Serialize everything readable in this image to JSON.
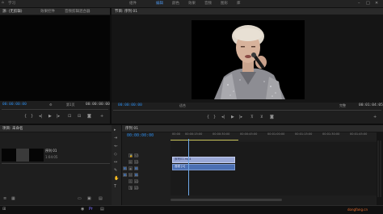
{
  "menu": {
    "items": [
      "学习",
      "组件",
      "编辑",
      "颜色",
      "效果",
      "音频",
      "图形",
      "库"
    ],
    "active_index": 2
  },
  "source_panel": {
    "tabs": [
      "源: (无剪辑)",
      "效果控件",
      "音频剪辑混合器"
    ],
    "timecode_left": "00:00:00:00",
    "timecode_right": "00:00:00:00",
    "page_label": "第1页"
  },
  "program_panel": {
    "tab": "节目: 序列 01",
    "timecode_left": "00:00:00:00",
    "fit_label": "适合",
    "ratio_label": "完整",
    "timecode_right": "00:01:04:05"
  },
  "project_panel": {
    "tab": "项目: 未命名",
    "clip_name": "序列 01",
    "clip_duration": "1:04:05"
  },
  "timeline_panel": {
    "tab": "序列 01",
    "timecode": "00:00:00:00",
    "ruler_labels": [
      "00:00",
      "00:00:15:00",
      "00:00:30:00",
      "00:00:45:00",
      "00:01:00:00",
      "00:01:15:00",
      "00:01:30:00",
      "00:01:45:00"
    ],
    "video_clip_label": "序列01.mp4",
    "audio_clip_label": "音频 [V]",
    "track_labels": [
      "V3",
      "V2",
      "V1",
      "A1",
      "A2",
      "A3"
    ]
  },
  "icons": {
    "play": "play-icon",
    "step_back": "step-back-icon",
    "step_forward": "step-forward-icon",
    "mark_in": "mark-in-icon",
    "mark_out": "mark-out-icon",
    "export_frame": "camera-icon",
    "settings": "wrench-icon",
    "add": "plus-icon"
  },
  "colors": {
    "accent_blue": "#2d8ceb",
    "clip_video": "#9aa8d6",
    "clip_audio": "#4b6fb3",
    "playhead": "#6fa8e8",
    "work_area": "#c8c25b"
  },
  "watermark": "dongfang.cn"
}
